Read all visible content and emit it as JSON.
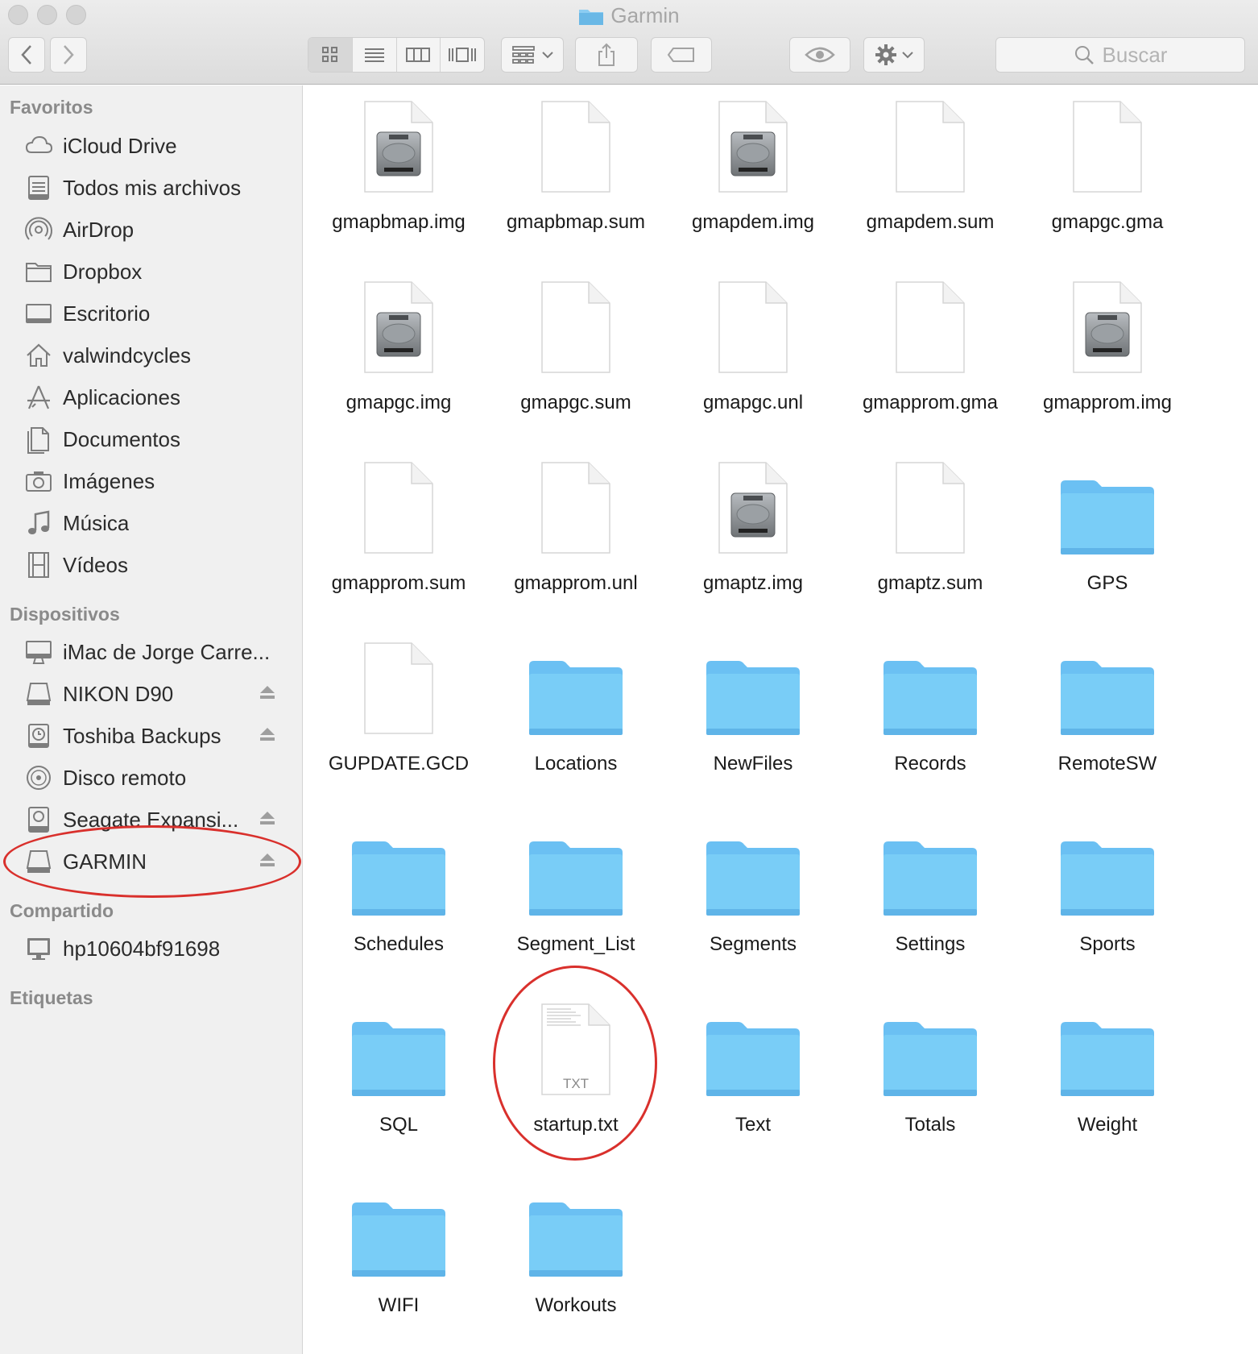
{
  "window": {
    "title": "Garmin",
    "search_placeholder": "Buscar"
  },
  "toolbar": {
    "icons": [
      "back-icon",
      "forward-icon",
      "icon-view-icon",
      "list-view-icon",
      "column-view-icon",
      "cover-flow-icon",
      "arrange-icon",
      "share-icon",
      "tag-icon",
      "quicklook-icon",
      "action-gear-icon",
      "search-icon"
    ]
  },
  "sidebar": {
    "favorites_title": "Favoritos",
    "favorites": [
      {
        "label": "iCloud Drive",
        "icon": "cloud"
      },
      {
        "label": "Todos mis archivos",
        "icon": "allfiles"
      },
      {
        "label": "AirDrop",
        "icon": "airdrop"
      },
      {
        "label": "Dropbox",
        "icon": "folder"
      },
      {
        "label": "Escritorio",
        "icon": "desktop"
      },
      {
        "label": "valwindcycles",
        "icon": "home"
      },
      {
        "label": "Aplicaciones",
        "icon": "apps"
      },
      {
        "label": "Documentos",
        "icon": "docs"
      },
      {
        "label": "Imágenes",
        "icon": "camera"
      },
      {
        "label": "Música",
        "icon": "music"
      },
      {
        "label": "Vídeos",
        "icon": "film"
      }
    ],
    "devices_title": "Dispositivos",
    "devices": [
      {
        "label": "iMac de Jorge Carre...",
        "icon": "imac",
        "eject": false
      },
      {
        "label": "NIKON D90",
        "icon": "drive",
        "eject": true
      },
      {
        "label": "Toshiba Backups",
        "icon": "timemachine",
        "eject": true
      },
      {
        "label": "Disco remoto",
        "icon": "disc",
        "eject": false
      },
      {
        "label": "Seagate Expansi...",
        "icon": "hdd",
        "eject": true
      },
      {
        "label": "GARMIN",
        "icon": "drive",
        "eject": true
      }
    ],
    "shared_title": "Compartido",
    "shared": [
      {
        "label": "hp10604bf91698",
        "icon": "monitor"
      }
    ],
    "tags_title": "Etiquetas"
  },
  "files": [
    {
      "name": "gmapbmap.img",
      "type": "img"
    },
    {
      "name": "gmapbmap.sum",
      "type": "doc"
    },
    {
      "name": "gmapdem.img",
      "type": "img"
    },
    {
      "name": "gmapdem.sum",
      "type": "doc"
    },
    {
      "name": "gmapgc.gma",
      "type": "doc"
    },
    {
      "name": "gmapgc.img",
      "type": "img"
    },
    {
      "name": "gmapgc.sum",
      "type": "doc"
    },
    {
      "name": "gmapgc.unl",
      "type": "doc"
    },
    {
      "name": "gmapprom.gma",
      "type": "doc"
    },
    {
      "name": "gmapprom.img",
      "type": "img"
    },
    {
      "name": "gmapprom.sum",
      "type": "doc"
    },
    {
      "name": "gmapprom.unl",
      "type": "doc"
    },
    {
      "name": "gmaptz.img",
      "type": "img"
    },
    {
      "name": "gmaptz.sum",
      "type": "doc"
    },
    {
      "name": "GPS",
      "type": "folder"
    },
    {
      "name": "GUPDATE.GCD",
      "type": "doc"
    },
    {
      "name": "Locations",
      "type": "folder"
    },
    {
      "name": "NewFiles",
      "type": "folder"
    },
    {
      "name": "Records",
      "type": "folder"
    },
    {
      "name": "RemoteSW",
      "type": "folder"
    },
    {
      "name": "Schedules",
      "type": "folder"
    },
    {
      "name": "Segment_List",
      "type": "folder"
    },
    {
      "name": "Segments",
      "type": "folder"
    },
    {
      "name": "Settings",
      "type": "folder"
    },
    {
      "name": "Sports",
      "type": "folder"
    },
    {
      "name": "SQL",
      "type": "folder"
    },
    {
      "name": "startup.txt",
      "type": "txt",
      "badge": "TXT"
    },
    {
      "name": "Text",
      "type": "folder"
    },
    {
      "name": "Totals",
      "type": "folder"
    },
    {
      "name": "Weight",
      "type": "folder"
    },
    {
      "name": "WIFI",
      "type": "folder"
    },
    {
      "name": "Workouts",
      "type": "folder"
    }
  ],
  "colors": {
    "folder": "#6cc7f6",
    "annotation": "#d9302c",
    "sidebar_bg": "#f0f0f0"
  }
}
